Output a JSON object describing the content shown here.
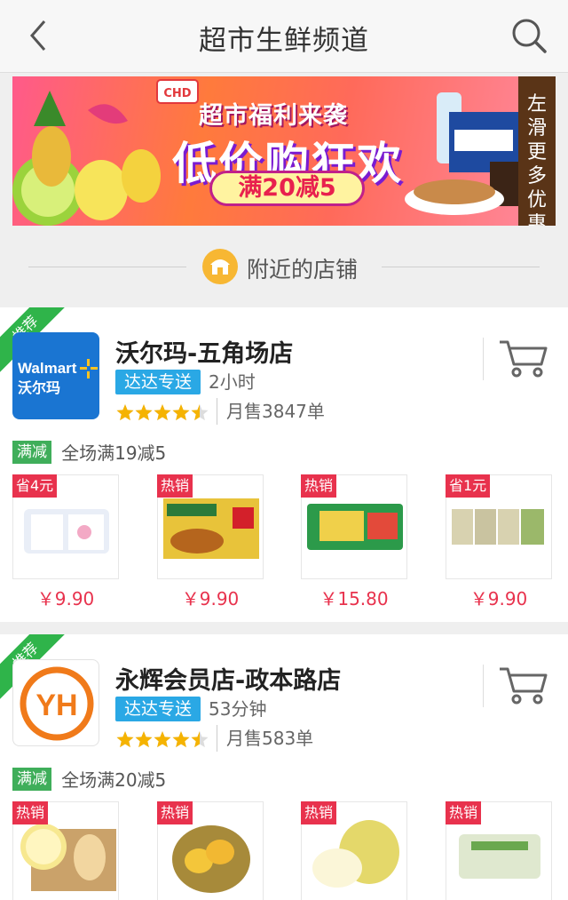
{
  "header": {
    "title": "超市生鲜频道"
  },
  "banner": {
    "brand_mark": "CHD",
    "subtitle": "超市福利来袭",
    "headline": "低价购狂欢",
    "promo": "满20减5",
    "side_tab": [
      "左",
      "滑",
      "更",
      "多",
      "优",
      "惠"
    ],
    "colors": {
      "bg_start": "#ff5a8a",
      "bg_end": "#ff8aa0",
      "side_tab": "#5a3417"
    }
  },
  "section": {
    "label": "附近的店铺"
  },
  "stores": [
    {
      "ribbon": "推荐",
      "logo": {
        "icon": "walmart-logo",
        "line1": "Walmart",
        "line2": "沃尔玛",
        "bg": "#1a75d2"
      },
      "name": "沃尔玛-五角场店",
      "delivery_badge": "达达专送",
      "eta": "2小时",
      "rating": 4.5,
      "sales": "月售3847单",
      "promo_tag": "满减",
      "promo_text": "全场满19减5",
      "products": [
        {
          "tag": "省4元",
          "price": "￥9.90",
          "thumb": "tissue-pack"
        },
        {
          "tag": "热销",
          "price": "￥9.90",
          "thumb": "curry-box"
        },
        {
          "tag": "热销",
          "price": "￥15.80",
          "thumb": "snack-pack"
        },
        {
          "tag": "省1元",
          "price": "￥9.90",
          "thumb": "cup-noodles"
        }
      ]
    },
    {
      "ribbon": "推荐",
      "logo": {
        "icon": "yh-logo",
        "line1": "YH",
        "bg": "#ffffff",
        "accent": "#f07a1a"
      },
      "name": "永辉会员店-政本路店",
      "delivery_badge": "达达专送",
      "eta": "53分钟",
      "rating": 4.5,
      "sales": "月售583单",
      "promo_tag": "满减",
      "promo_text": "全场满20减5",
      "products": [
        {
          "tag": "热销",
          "thumb": "citrus-slices"
        },
        {
          "tag": "热销",
          "thumb": "mango-basket"
        },
        {
          "tag": "热销",
          "thumb": "pear"
        },
        {
          "tag": "热销",
          "thumb": "egg-tray"
        }
      ]
    }
  ]
}
